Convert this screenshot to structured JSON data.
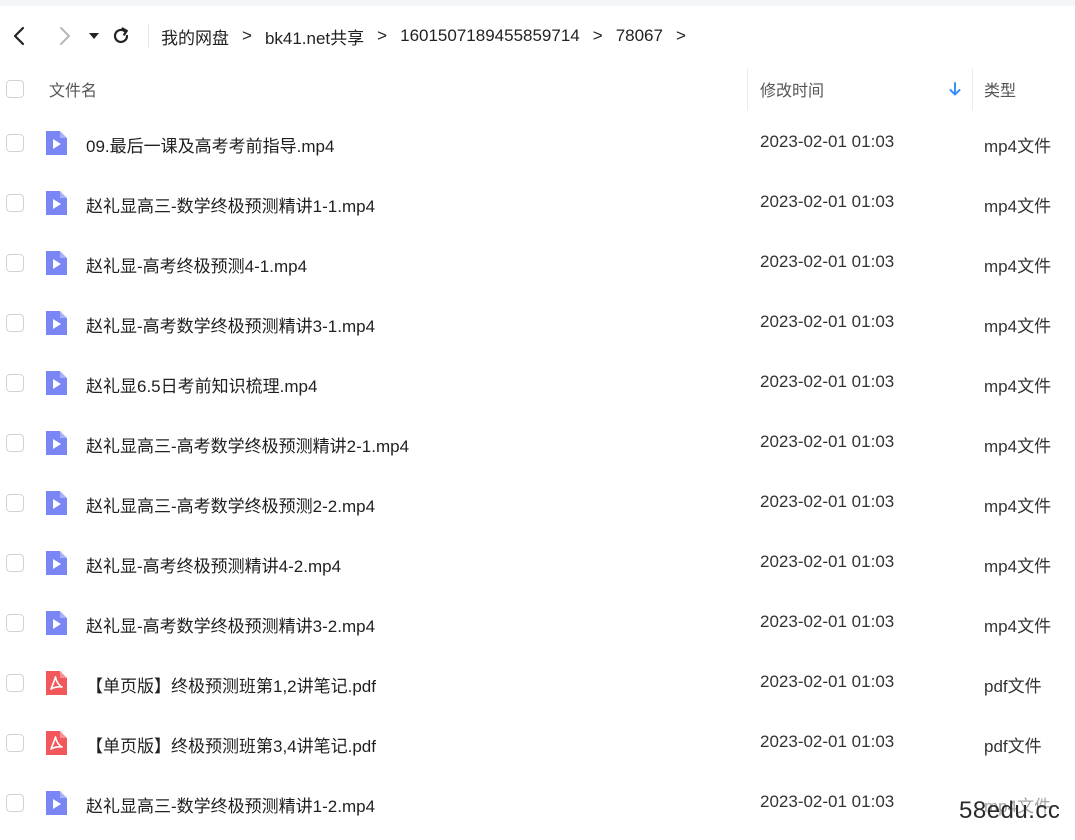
{
  "breadcrumb": [
    "我的网盘",
    "bk41.net共享",
    "1601507189455859714",
    "78067"
  ],
  "breadcrumb_separator": ">",
  "columns": {
    "name": "文件名",
    "time": "修改时间",
    "type": "类型"
  },
  "colors": {
    "video_icon": "#7b86f5",
    "pdf_icon": "#f2575c",
    "sort_arrow": "#3a8ef6"
  },
  "files": [
    {
      "name": "09.最后一课及高考考前指导.mp4",
      "time": "2023-02-01 01:03",
      "type": "mp4文件",
      "icon": "video-file-icon"
    },
    {
      "name": "赵礼显高三-数学终极预测精讲1-1.mp4",
      "time": "2023-02-01 01:03",
      "type": "mp4文件",
      "icon": "video-file-icon"
    },
    {
      "name": "赵礼显-高考终极预测4-1.mp4",
      "time": "2023-02-01 01:03",
      "type": "mp4文件",
      "icon": "video-file-icon"
    },
    {
      "name": "赵礼显-高考数学终极预测精讲3-1.mp4",
      "time": "2023-02-01 01:03",
      "type": "mp4文件",
      "icon": "video-file-icon"
    },
    {
      "name": "赵礼显6.5日考前知识梳理.mp4",
      "time": "2023-02-01 01:03",
      "type": "mp4文件",
      "icon": "video-file-icon"
    },
    {
      "name": "赵礼显高三-高考数学终极预测精讲2-1.mp4",
      "time": "2023-02-01 01:03",
      "type": "mp4文件",
      "icon": "video-file-icon"
    },
    {
      "name": "赵礼显高三-高考数学终极预测2-2.mp4",
      "time": "2023-02-01 01:03",
      "type": "mp4文件",
      "icon": "video-file-icon"
    },
    {
      "name": "赵礼显-高考终极预测精讲4-2.mp4",
      "time": "2023-02-01 01:03",
      "type": "mp4文件",
      "icon": "video-file-icon"
    },
    {
      "name": "赵礼显-高考数学终极预测精讲3-2.mp4",
      "time": "2023-02-01 01:03",
      "type": "mp4文件",
      "icon": "video-file-icon"
    },
    {
      "name": "【单页版】终极预测班第1,2讲笔记.pdf",
      "time": "2023-02-01 01:03",
      "type": "pdf文件",
      "icon": "pdf-file-icon"
    },
    {
      "name": "【单页版】终极预测班第3,4讲笔记.pdf",
      "time": "2023-02-01 01:03",
      "type": "pdf文件",
      "icon": "pdf-file-icon"
    },
    {
      "name": "赵礼显高三-数学终极预测精讲1-2.mp4",
      "time": "2023-02-01 01:03",
      "type": "mp4文件",
      "icon": "video-file-icon"
    }
  ],
  "watermark": "58edu.cc"
}
